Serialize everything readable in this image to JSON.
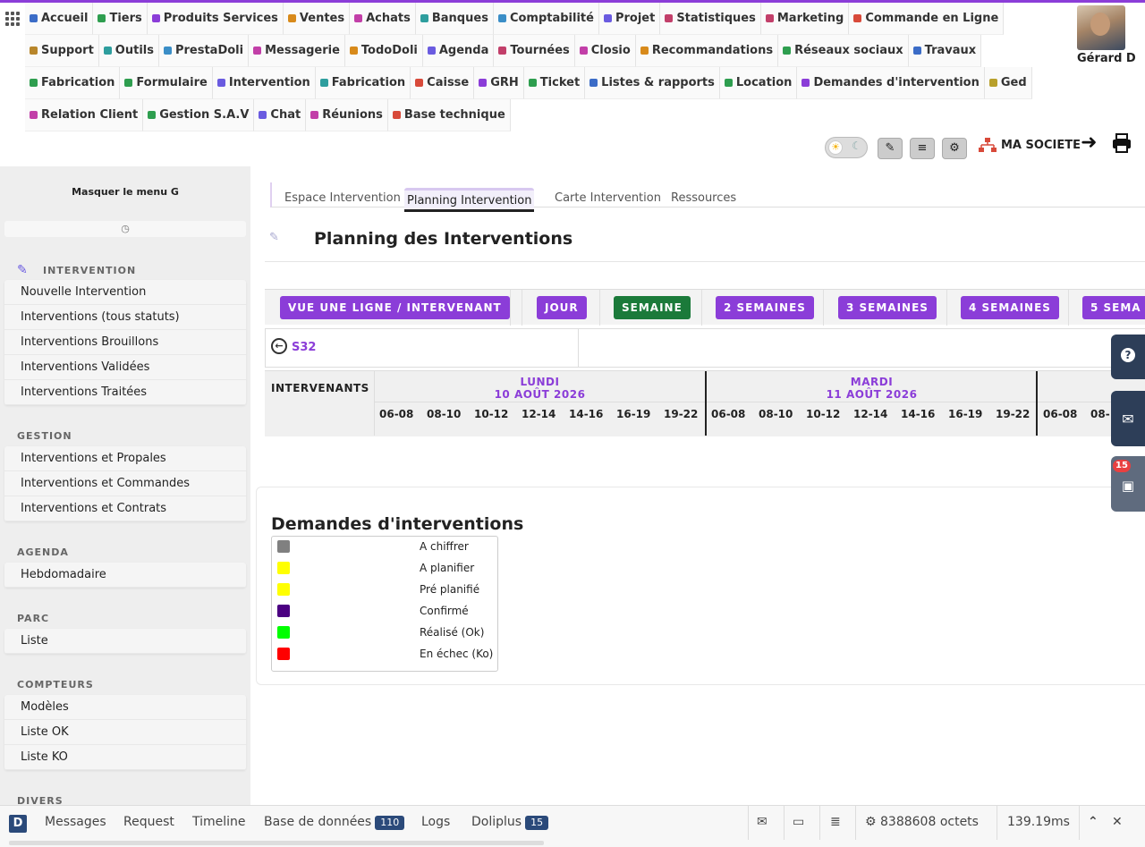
{
  "topmenu": {
    "row1": [
      {
        "label": "Accueil",
        "color": "#3b6cc7"
      },
      {
        "label": "Tiers",
        "color": "#2e9e4f"
      },
      {
        "label": "Produits Services",
        "color": "#8b3dd8"
      },
      {
        "label": "Ventes",
        "color": "#d88a1b"
      },
      {
        "label": "Achats",
        "color": "#c23fa8"
      },
      {
        "label": "Banques",
        "color": "#2e9e9e"
      },
      {
        "label": "Comptabilité",
        "color": "#3b8ec7"
      },
      {
        "label": "Projet",
        "color": "#6a5be0"
      },
      {
        "label": "Statistiques",
        "color": "#c23f6a"
      },
      {
        "label": "Marketing",
        "color": "#c23f6a"
      },
      {
        "label": "Commande en Ligne",
        "color": "#d84a3a"
      }
    ],
    "row2": [
      {
        "label": "Support",
        "color": "#b8862b"
      },
      {
        "label": "Outils",
        "color": "#2e9e9e"
      },
      {
        "label": "PrestaDoli",
        "color": "#3b8ec7"
      },
      {
        "label": "Messagerie",
        "color": "#c23fa8"
      },
      {
        "label": "TodoDoli",
        "color": "#d88a1b"
      },
      {
        "label": "Agenda",
        "color": "#6a5be0"
      },
      {
        "label": "Tournées",
        "color": "#c23f6a"
      },
      {
        "label": "Closio",
        "color": "#c23fa8"
      },
      {
        "label": "Recommandations",
        "color": "#d88a1b"
      },
      {
        "label": "Réseaux sociaux",
        "color": "#2e9e4f"
      },
      {
        "label": "Travaux",
        "color": "#3b6cc7"
      }
    ],
    "row3": [
      {
        "label": "Fabrication",
        "color": "#2e9e4f"
      },
      {
        "label": "Formulaire",
        "color": "#2e9e4f"
      },
      {
        "label": "Intervention",
        "color": "#6a5be0"
      },
      {
        "label": "Fabrication",
        "color": "#2e9e9e"
      },
      {
        "label": "Caisse",
        "color": "#d84a3a"
      },
      {
        "label": "GRH",
        "color": "#8b3dd8"
      },
      {
        "label": "Ticket",
        "color": "#2e9e4f"
      },
      {
        "label": "Listes & rapports",
        "color": "#3b6cc7"
      },
      {
        "label": "Location",
        "color": "#2e9e4f"
      },
      {
        "label": "Demandes d'intervention",
        "color": "#8b3dd8"
      },
      {
        "label": "Ged",
        "color": "#b8a02b"
      }
    ],
    "row4": [
      {
        "label": "Relation Client",
        "color": "#c23fa8"
      },
      {
        "label": "Gestion S.A.V",
        "color": "#2e9e4f"
      },
      {
        "label": "Chat",
        "color": "#6a5be0"
      },
      {
        "label": "Réunions",
        "color": "#c23fa8"
      },
      {
        "label": "Base technique",
        "color": "#d84a3a"
      }
    ]
  },
  "user": {
    "name": "Gérard D"
  },
  "toolbar": {
    "company": "MA SOCIETE"
  },
  "sidebar": {
    "hide_label": "Masquer le menu G",
    "sections": [
      {
        "title": "INTERVENTION",
        "items": [
          "Nouvelle Intervention",
          "Interventions (tous statuts)",
          "Interventions Brouillons",
          "Interventions Validées",
          "Interventions Traitées"
        ]
      },
      {
        "title": "GESTION",
        "items": [
          "Interventions et Propales",
          "Interventions et Commandes",
          "Interventions et Contrats"
        ]
      },
      {
        "title": "AGENDA",
        "items": [
          "Hebdomadaire"
        ]
      },
      {
        "title": "PARC",
        "items": [
          "Liste"
        ]
      },
      {
        "title": "COMPTEURS",
        "items": [
          "Modèles",
          "Liste OK",
          "Liste KO"
        ]
      },
      {
        "title": "DIVERS",
        "items": []
      }
    ]
  },
  "tabs": [
    "Espace Intervention",
    "Planning Intervention",
    "Carte Intervention",
    "Ressources"
  ],
  "active_tab": "Planning Intervention",
  "page_title": "Planning des Interventions",
  "views": [
    "VUE UNE LIGNE / INTERVENANT",
    "JOUR",
    "SEMAINE",
    "2 SEMAINES",
    "3 SEMAINES",
    "4 SEMAINES",
    "5 SEMA"
  ],
  "active_view": "SEMAINE",
  "week_label": "S32",
  "planning": {
    "header": "INTERVENANTS",
    "days": [
      {
        "name": "LUNDI",
        "date": "10 AOÛT 2026"
      },
      {
        "name": "MARDI",
        "date": "11 AOÛT 2026"
      }
    ],
    "slots": [
      "06-08",
      "08-10",
      "10-12",
      "12-14",
      "14-16",
      "16-19",
      "19-22"
    ],
    "partial_slots": [
      "06-08",
      "08-"
    ]
  },
  "legend": {
    "title": "Demandes d'interventions",
    "items": [
      {
        "label": "A chiffrer",
        "color": "#808080"
      },
      {
        "label": "A planifier",
        "color": "#ffff00"
      },
      {
        "label": "Pré planifié",
        "color": "#ffff00"
      },
      {
        "label": "Confirmé",
        "color": "#4b0082"
      },
      {
        "label": "Réalisé (Ok)",
        "color": "#00ff00"
      },
      {
        "label": "En échec (Ko)",
        "color": "#ff0000"
      }
    ]
  },
  "side_widget": {
    "badge": "15"
  },
  "debugbar": {
    "logo": "D",
    "items": [
      {
        "label": "Messages"
      },
      {
        "label": "Request"
      },
      {
        "label": "Timeline"
      },
      {
        "label": "Base de données",
        "count": "110"
      },
      {
        "label": "Logs"
      },
      {
        "label": "Doliplus",
        "count": "15"
      }
    ],
    "memory": "8388608 octets",
    "time": "139.19ms"
  }
}
